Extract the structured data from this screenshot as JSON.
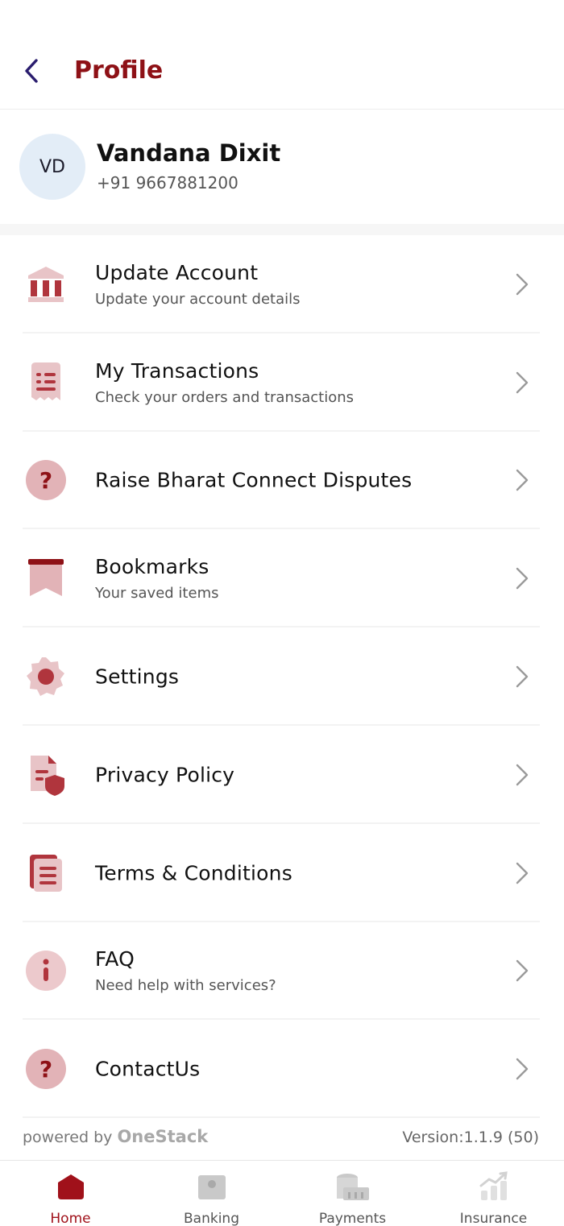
{
  "header": {
    "title": "Profile"
  },
  "profile": {
    "initials": "VD",
    "name": "Vandana Dixit",
    "phone": "+91 9667881200"
  },
  "menu": [
    {
      "icon": "bank-icon",
      "title": "Update Account",
      "subtitle": "Update your account details"
    },
    {
      "icon": "receipt-icon",
      "title": "My Transactions",
      "subtitle": "Check your orders and transactions"
    },
    {
      "icon": "question-icon",
      "title": "Raise Bharat Connect Disputes",
      "subtitle": ""
    },
    {
      "icon": "bookmark-icon",
      "title": "Bookmarks",
      "subtitle": "Your saved items"
    },
    {
      "icon": "gear-icon",
      "title": "Settings",
      "subtitle": ""
    },
    {
      "icon": "shield-document-icon",
      "title": "Privacy Policy",
      "subtitle": ""
    },
    {
      "icon": "document-icon",
      "title": "Terms & Conditions",
      "subtitle": ""
    },
    {
      "icon": "info-icon",
      "title": "FAQ",
      "subtitle": "Need help with services?"
    },
    {
      "icon": "question-icon",
      "title": "ContactUs",
      "subtitle": ""
    }
  ],
  "footer": {
    "powered_prefix": "powered by",
    "powered_brand": "OneStack",
    "version": "Version:1.1.9 (50)"
  },
  "nav": [
    {
      "label": "Home",
      "icon": "home-icon",
      "active": true
    },
    {
      "label": "Banking",
      "icon": "banking-icon",
      "active": false
    },
    {
      "label": "Payments",
      "icon": "payments-icon",
      "active": false
    },
    {
      "label": "Insurance",
      "icon": "insurance-icon",
      "active": false
    }
  ],
  "colors": {
    "accent": "#8e1116",
    "icon_light": "#e8c4c7",
    "icon_dark": "#b0353d",
    "avatar_bg": "#e3edf7"
  }
}
